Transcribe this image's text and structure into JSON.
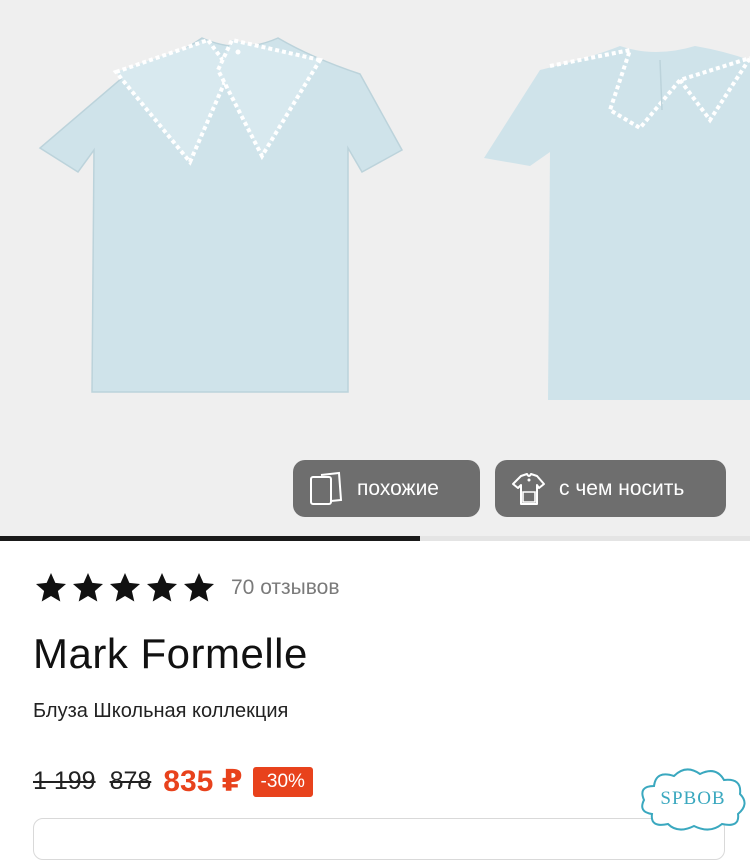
{
  "gallery": {
    "progress_fraction": 0.56,
    "buttons": {
      "similar_label": "похожие",
      "similar_icon": "similar-cards-icon",
      "wear_label": "с чем носить",
      "wear_icon": "outfit-icon"
    }
  },
  "product": {
    "rating": 5,
    "reviews_label": "70 отзывов",
    "brand": "Mark Formelle",
    "description": "Блуза Школьная коллекция",
    "prices": {
      "old": "1 199",
      "mid": "878",
      "current": "835 ₽",
      "discount": "-30%"
    }
  },
  "watermark": {
    "text": "SPBOB"
  },
  "colors": {
    "accent": "#e8421c",
    "shirt": "#cfe3ea",
    "pill_bg": "#6e6e6e"
  }
}
